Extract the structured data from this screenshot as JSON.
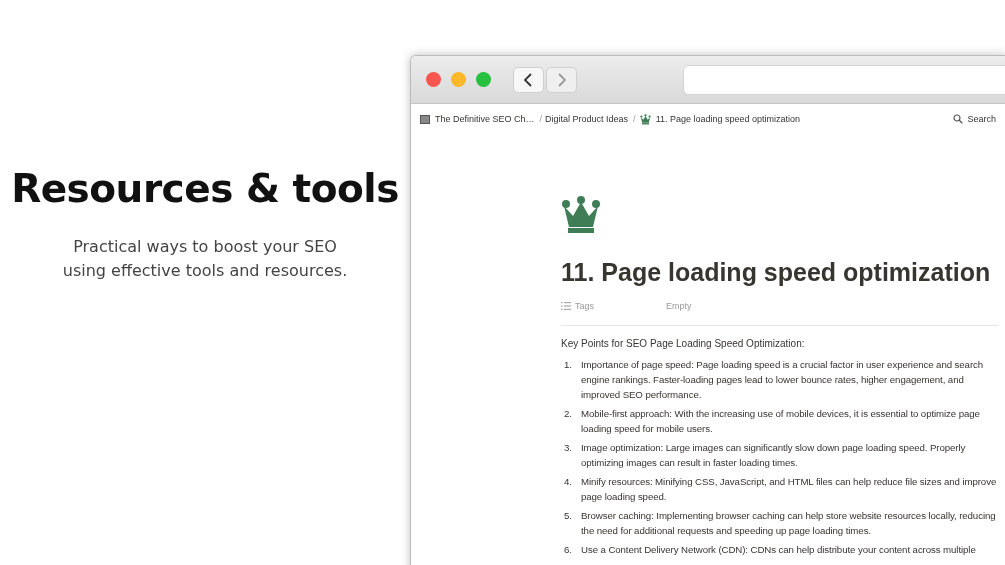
{
  "promo": {
    "heading": "Resources & tools",
    "subtitle": "Practical ways to boost your SEO using effective tools and resources."
  },
  "browser": {
    "nav_buttons": [
      {
        "kind": "back",
        "disabled": false
      },
      {
        "kind": "forward",
        "disabled": true
      }
    ]
  },
  "breadcrumbs": [
    {
      "text": "The Definitive SEO Ch…"
    },
    {
      "separator": "/",
      "text": "Digital Product Ideas"
    },
    {
      "separator": "/",
      "text": "11. Page loading speed optimization"
    }
  ],
  "search": {
    "label": "Search"
  },
  "page": {
    "title": "11. Page loading speed optimization",
    "properties": [
      {
        "label": "Tags",
        "value": "Empty"
      }
    ],
    "intro": "Key Points for SEO Page Loading Speed Optimization:",
    "items": [
      {
        "number": "1.",
        "text": "Importance of page speed: Page loading speed is a crucial factor in user experience and search engine rankings. Faster-loading pages lead to lower bounce rates, higher engagement, and improved SEO performance."
      },
      {
        "number": "2.",
        "text": "Mobile-first approach: With the increasing use of mobile devices, it is essential to optimize page loading speed for mobile users."
      },
      {
        "number": "3.",
        "text": "Image optimization: Large images can significantly slow down page loading speed. Properly optimizing images can result in faster loading times."
      },
      {
        "number": "4.",
        "text": "Minify resources: Minifying CSS, JavaScript, and HTML files can help reduce file sizes and improve page loading speed."
      },
      {
        "number": "5.",
        "text": "Browser caching: Implementing browser caching can help store website resources locally, reducing the need for additional requests and speeding up page loading times."
      },
      {
        "number": "6.",
        "text": "Use a Content Delivery Network (CDN): CDNs can help distribute your content across multiple"
      }
    ]
  }
}
